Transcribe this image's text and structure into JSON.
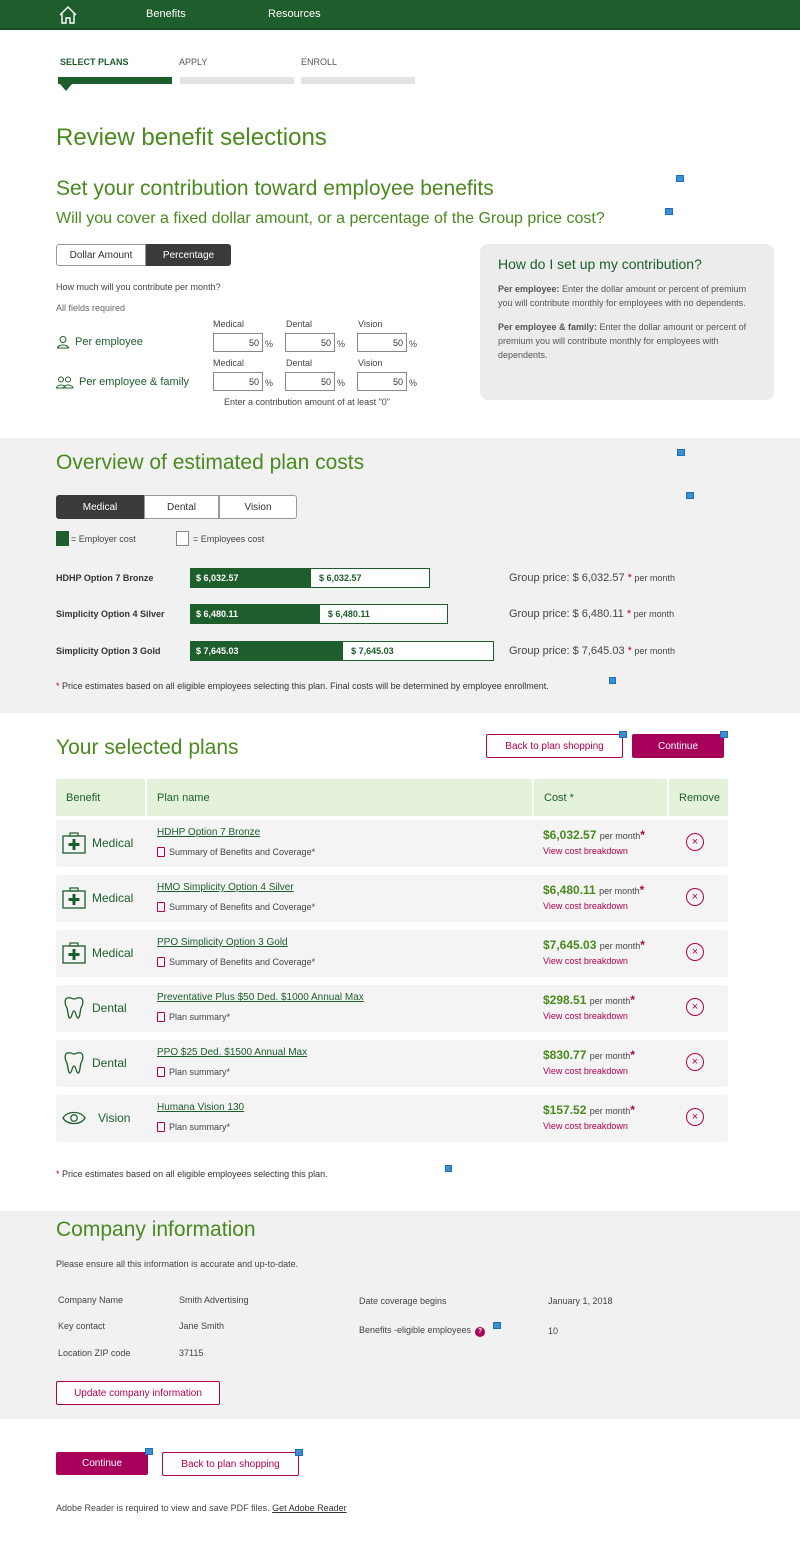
{
  "nav": {
    "links": [
      "Benefits",
      "Resources"
    ]
  },
  "steps": [
    "SELECT PLANS",
    "APPLY",
    "ENROLL"
  ],
  "page_title": "Review benefit selections",
  "contribution": {
    "title": "Set your contribution toward employee benefits",
    "subtitle": "Will you cover a fixed dollar amount, or a percentage of the Group price cost?",
    "toggle": [
      "Dollar Amount",
      "Percentage"
    ],
    "question": "How much will you contribute per month?",
    "required": "All fields required",
    "columns": [
      "Medical",
      "Dental",
      "Vision"
    ],
    "rows": [
      {
        "label": "Per employee",
        "values": [
          "50",
          "50",
          "50"
        ]
      },
      {
        "label": "Per employee & family",
        "values": [
          "50",
          "50",
          "50"
        ]
      }
    ],
    "pct_symbol": "%",
    "hint": "Enter a contribution amount of at least \"0\""
  },
  "help": {
    "title": "How do I set up my contribution?",
    "p1_bold": "Per employee:",
    "p1_text": " Enter the dollar amount or percent of premium you will contribute monthly for employees with no dependents.",
    "p2_bold": "Per employee & family:",
    "p2_text": " Enter the dollar amount or percent of premium you will contribute monthly for employees with dependents."
  },
  "overview": {
    "title": "Overview of estimated plan costs",
    "tabs": [
      "Medical",
      "Dental",
      "Vision"
    ],
    "legend_employer": "= Employer cost",
    "legend_employee": "= Employees cost",
    "group_price_prefix": "Group price: ",
    "star": "*",
    "per_month": "per month",
    "footnote": " Price estimates based on all eligible employees selecting this plan. Final costs will be determined by employee enrollment."
  },
  "chart_data": {
    "type": "bar",
    "categories": [
      "HDHP Option 7 Bronze",
      "Simplicity Option 4 Silver",
      "Simplicity Option 3 Gold"
    ],
    "series": [
      {
        "name": "Employer cost",
        "values": [
          6032.57,
          6480.11,
          7645.03
        ],
        "labels": [
          "$ 6,032.57",
          "$ 6,480.11",
          "$ 7,645.03"
        ]
      },
      {
        "name": "Employees cost",
        "values": [
          6032.57,
          6480.11,
          7645.03
        ],
        "labels": [
          "$ 6,032.57",
          "$ 6,480.11",
          "$ 7,645.03"
        ]
      }
    ],
    "group_prices": [
      "$ 6,032.57",
      "$ 6,480.11",
      "$ 7,645.03"
    ],
    "colors": {
      "employer": "#1e5d2c",
      "employee": "#ffffff"
    }
  },
  "selected": {
    "title": "Your selected plans",
    "back_label": "Back to plan shopping",
    "continue_label": "Continue",
    "headers": [
      "Benefit",
      "Plan  name",
      "Cost *",
      "Remove"
    ],
    "per_month": "per month",
    "star": "*",
    "breakdown": "View cost breakdown",
    "plans": [
      {
        "benefit": "Medical",
        "icon": "medical-kit-icon",
        "name": "HDHP Option 7 Bronze",
        "doc": "Summary of Benefits and Coverage*",
        "cost": "$6,032.57"
      },
      {
        "benefit": "Medical",
        "icon": "medical-kit-icon",
        "name": "HMO Simplicity Option 4 Silver",
        "doc": "Summary of Benefits and Coverage*",
        "cost": "$6,480.11"
      },
      {
        "benefit": "Medical",
        "icon": "medical-kit-icon",
        "name": "PPO Simplicity Option 3 Gold",
        "doc": "Summary of Benefits and Coverage*",
        "cost": "$7,645.03"
      },
      {
        "benefit": "Dental",
        "icon": "tooth-icon",
        "name": "Preventative Plus $50 Ded. $1000 Annual Max",
        "doc": "Plan summary*",
        "cost": "$298.51"
      },
      {
        "benefit": "Dental",
        "icon": "tooth-icon",
        "name": "PPO $25 Ded. $1500 Annual Max",
        "doc": "Plan summary*",
        "cost": "$830.77"
      },
      {
        "benefit": "Vision",
        "icon": "eye-icon",
        "name": "Humana Vision 130",
        "doc": "Plan summary*",
        "cost": "$157.52"
      }
    ],
    "footnote": " Price estimates based on all eligible employees selecting this plan."
  },
  "company": {
    "title": "Company information",
    "note": "Please ensure all this information is accurate and up-to-date.",
    "fields": [
      {
        "label": "Company Name",
        "value": "Smith Advertising"
      },
      {
        "label": "Key contact",
        "value": "Jane Smith"
      },
      {
        "label": "Location ZIP code",
        "value": "37115"
      }
    ],
    "coverage_label": "Date coverage begins",
    "coverage_value": "January 1, 2018",
    "eligible_label": "Benefits -eligible employees",
    "eligible_value": "10",
    "help_glyph": "?",
    "update_label": "Update company information"
  },
  "footer": {
    "continue_label": "Continue",
    "back_label": "Back to plan shopping",
    "adobe_text": "Adobe Reader is required to view and save PDF files. ",
    "adobe_link": "Get Adobe Reader"
  }
}
